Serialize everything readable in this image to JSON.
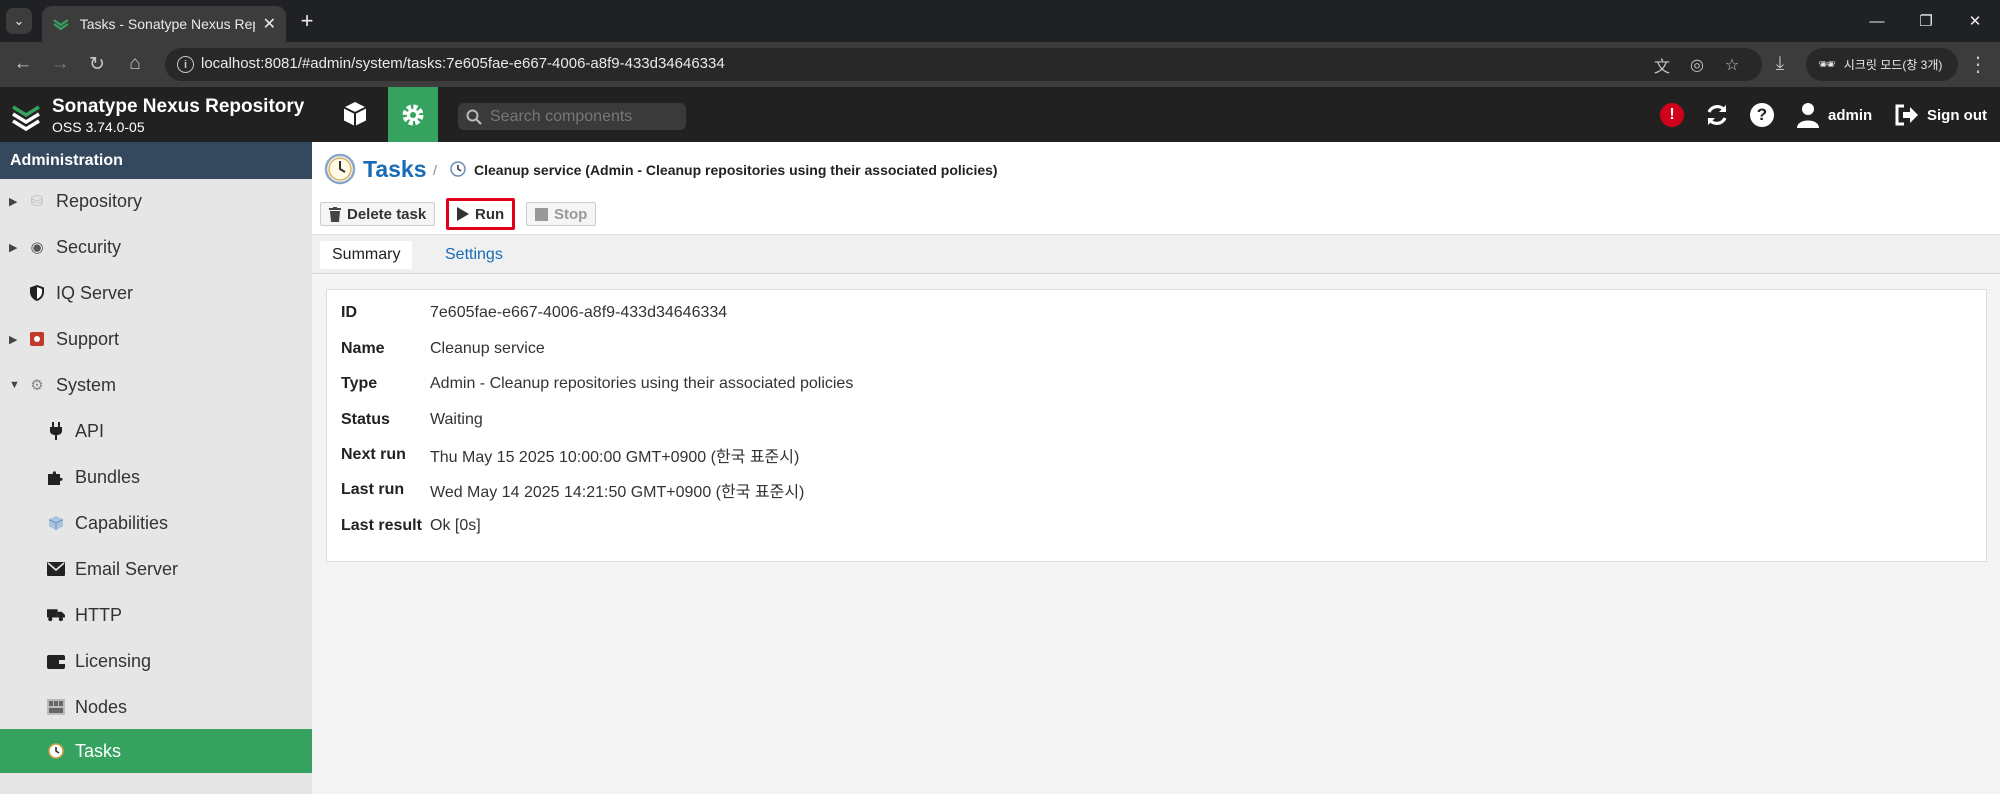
{
  "browser": {
    "tab_title": "Tasks - Sonatype Nexus Repos",
    "url": "localhost:8081/#admin/system/tasks:7e605fae-e667-4006-a8f9-433d34646334",
    "incognito_label": "시크릿 모드(창 3개)"
  },
  "header": {
    "product_name": "Sonatype Nexus Repository",
    "version": "OSS 3.74.0-05",
    "search_placeholder": "Search components",
    "user_name": "admin",
    "signout_label": "Sign out"
  },
  "sidebar": {
    "title": "Administration",
    "items": [
      {
        "label": "Repository"
      },
      {
        "label": "Security"
      },
      {
        "label": "IQ Server"
      },
      {
        "label": "Support"
      },
      {
        "label": "System"
      },
      {
        "label": "API"
      },
      {
        "label": "Bundles"
      },
      {
        "label": "Capabilities"
      },
      {
        "label": "Email Server"
      },
      {
        "label": "HTTP"
      },
      {
        "label": "Licensing"
      },
      {
        "label": "Nodes"
      },
      {
        "label": "Tasks"
      }
    ]
  },
  "breadcrumb": {
    "root": "Tasks",
    "separator": "/",
    "current": "Cleanup service (Admin - Cleanup repositories using their associated policies)"
  },
  "toolbar": {
    "delete_label": "Delete task",
    "run_label": "Run",
    "stop_label": "Stop"
  },
  "tabs": {
    "summary": "Summary",
    "settings": "Settings"
  },
  "summary": {
    "rows": [
      {
        "key": "ID",
        "value": "7e605fae-e667-4006-a8f9-433d34646334"
      },
      {
        "key": "Name",
        "value": "Cleanup service"
      },
      {
        "key": "Type",
        "value": "Admin - Cleanup repositories using their associated policies"
      },
      {
        "key": "Status",
        "value": "Waiting"
      },
      {
        "key": "Next run",
        "value": "Thu May 15 2025 10:00:00 GMT+0900 (한국 표준시)"
      },
      {
        "key": "Last run",
        "value": "Wed May 14 2025 14:21:50 GMT+0900 (한국 표준시)"
      },
      {
        "key": "Last result",
        "value": "Ok [0s]"
      }
    ]
  },
  "colors": {
    "accent_green": "#35a35f",
    "link_blue": "#1a6bb5",
    "highlight_red": "#e0001a",
    "header_dark": "#212121",
    "sidebar_header": "#34495e"
  }
}
